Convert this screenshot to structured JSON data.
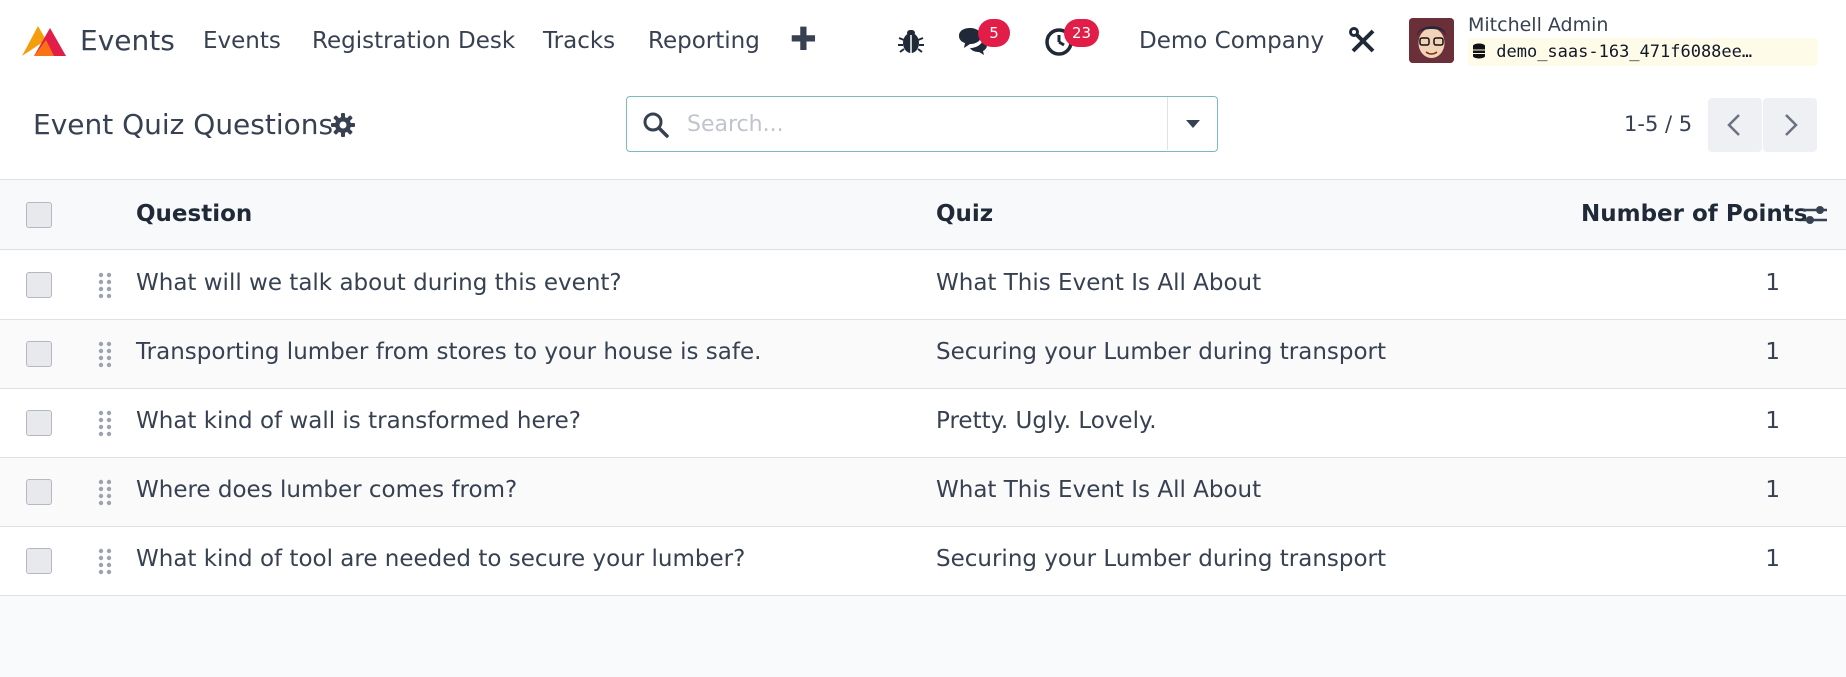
{
  "navbar": {
    "app_name": "Events",
    "menu": [
      "Events",
      "Registration Desk",
      "Tracks",
      "Reporting"
    ],
    "messages_count": "5",
    "activities_count": "23",
    "company": "Demo Company",
    "user_name": "Mitchell Admin",
    "database": "demo_saas-163_471f6088ee…"
  },
  "control_panel": {
    "title": "Event Quiz Questions",
    "search_placeholder": "Search...",
    "pager": "1-5 / 5"
  },
  "table": {
    "columns": [
      "Question",
      "Quiz",
      "Number of Points"
    ],
    "rows": [
      {
        "question": "What will we talk about during this event?",
        "quiz": "What This Event Is All About",
        "points": "1"
      },
      {
        "question": "Transporting lumber from stores to your house is safe.",
        "quiz": "Securing your Lumber during transport",
        "points": "1"
      },
      {
        "question": "What kind of wall is transformed here?",
        "quiz": "Pretty. Ugly. Lovely.",
        "points": "1"
      },
      {
        "question": "Where does lumber comes from?",
        "quiz": "What This Event Is All About",
        "points": "1"
      },
      {
        "question": "What kind of tool are needed to secure your lumber?",
        "quiz": "Securing your Lumber during transport",
        "points": "1"
      }
    ]
  },
  "colors": {
    "accent": "#7cb9bd",
    "badge": "#e11d48",
    "db_chip": "#fefce8"
  }
}
